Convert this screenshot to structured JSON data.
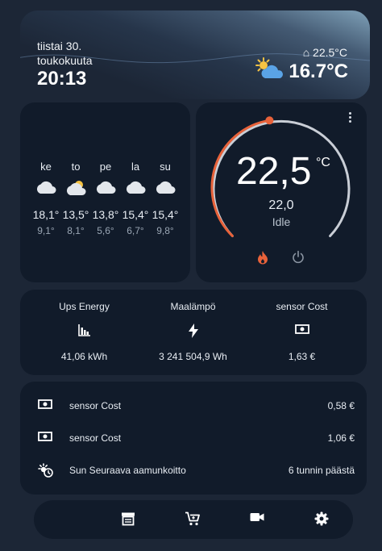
{
  "header": {
    "date_line1": "tiistai 30.",
    "date_line2": "toukokuuta",
    "time": "20:13",
    "inside_temp": "⌂ 22.5°C",
    "outside_temp": "16.7°C",
    "weather_icon": "partly-cloudy-icon"
  },
  "forecast": {
    "days": [
      {
        "day": "ke",
        "high": "18,1°",
        "low": "9,1°",
        "icon": "cloudy-icon"
      },
      {
        "day": "to",
        "high": "13,5°",
        "low": "8,1°",
        "icon": "partly-cloudy-icon"
      },
      {
        "day": "pe",
        "high": "13,8°",
        "low": "5,6°",
        "icon": "cloudy-icon"
      },
      {
        "day": "la",
        "high": "15,4°",
        "low": "6,7°",
        "icon": "cloudy-icon"
      },
      {
        "day": "su",
        "high": "15,4°",
        "low": "9,8°",
        "icon": "cloudy-icon"
      }
    ]
  },
  "thermostat": {
    "setpoint": "22,5",
    "unit": "°C",
    "current": "22,0",
    "state": "Idle",
    "accent": "#e8623a"
  },
  "energy": {
    "items": [
      {
        "label": "Ups Energy",
        "value": "41,06 kWh",
        "icon": "chart-bar-icon"
      },
      {
        "label": "Maalämpö",
        "value": "3 241 504,9 Wh",
        "icon": "lightning-icon"
      },
      {
        "label": "sensor Cost",
        "value": "1,63 €",
        "icon": "cash-icon"
      }
    ]
  },
  "list": {
    "rows": [
      {
        "label": "sensor Cost",
        "value": "0,58 €",
        "icon": "cash-icon"
      },
      {
        "label": "sensor Cost",
        "value": "1,06 €",
        "icon": "cash-icon"
      },
      {
        "label": "Sun Seuraava aamunkoitto",
        "value": "6 tunnin päästä",
        "icon": "sunrise-clock-icon"
      }
    ]
  },
  "nav": {
    "items": [
      "archive-icon",
      "cart-icon",
      "video-camera-icon",
      "gear-icon"
    ]
  }
}
